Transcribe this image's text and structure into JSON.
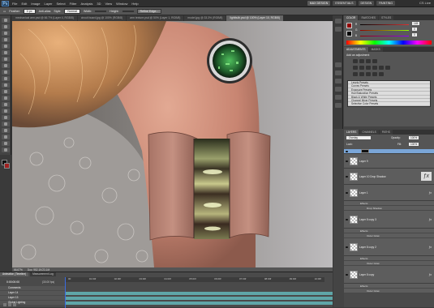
{
  "app": {
    "logo": "Ps"
  },
  "menubar": {
    "items": [
      "File",
      "Edit",
      "Image",
      "Layer",
      "Select",
      "Filter",
      "Analysis",
      "3D",
      "View",
      "Window",
      "Help"
    ],
    "zoom": "66.7",
    "workspaces": [
      "MAX DESIGN",
      "ESSENTIALS",
      "DESIGN",
      "PAINTING"
    ],
    "cs_live": "CS Live"
  },
  "options_bar": {
    "feather_label": "Feather:",
    "feather_value": "0 px",
    "antialias_label": "Anti-alias",
    "style_label": "Style:",
    "style_value": "Normal",
    "width_label": "Width:",
    "height_label": "Height:",
    "refine_edge": "Refine Edge..."
  },
  "doc_tabs": [
    {
      "label": "mechanical arm.psd @ 66.7% (Layer 4, RGB/8)",
      "active": false
    },
    {
      "label": "circuit board.jpg @ 100% (RGB/8)",
      "active": false
    },
    {
      "label": "arm texture.psd @ 50% (Layer 1, RGB/8)",
      "active": false
    },
    {
      "label": "model.jpg @ 33.3% (RGB/8)",
      "active": false
    },
    {
      "label": "lightbulb.psd @ 100% (Layer 10, RGB/8)",
      "active": true
    }
  ],
  "status": {
    "zoom": "66.67%",
    "doc": "Doc: 952.1K/23.1M"
  },
  "animation": {
    "tabs": [
      "Animation (Timeline)",
      "Measurement Log"
    ],
    "current_time": "0:00:00:00",
    "fps": "(30.00 fps)",
    "ruler_ticks": [
      "00",
      "01:00f",
      "02:00f",
      "03:00f",
      "04:00f",
      "05:00f",
      "06:00f",
      "07:00f",
      "08:00f",
      "09:00f",
      "10:00f"
    ],
    "tracks": [
      "Comments",
      "Layer 14",
      "Layer 13",
      "Global Lighting"
    ]
  },
  "color_panel": {
    "tabs": [
      "COLOR",
      "SWATCHES",
      "STYLES"
    ],
    "channels": [
      "R",
      "G",
      "B"
    ],
    "values": [
      "145",
      "0",
      "0"
    ],
    "channel_colors": [
      "#e03030",
      "#30c040",
      "#3050e0"
    ]
  },
  "adjustments_panel": {
    "tabs": [
      "ADJUSTMENTS",
      "MASKS"
    ],
    "title": "Add an adjustment",
    "presets": [
      "Levels Presets",
      "Curves Presets",
      "Exposure Presets",
      "Hue/Saturation Presets",
      "Black & White Presets",
      "Channel Mixer Presets",
      "Selective Color Presets"
    ]
  },
  "layers_panel": {
    "tabs": [
      "LAYERS",
      "CHANNELS",
      "PATHS"
    ],
    "blend_mode": "Overlay",
    "opacity_label": "Opacity:",
    "opacity_value": "100%",
    "lock_label": "Lock:",
    "fill_label": "Fill:",
    "fill_value": "100%",
    "layers": [
      {
        "name": "Layer 10",
        "fx": false
      },
      {
        "name": "Layer 9",
        "fx": false
      },
      {
        "name": "Layer 10 Drop Shadow",
        "fx": true
      },
      {
        "name": "Layer 1",
        "fx": true
      },
      {
        "name": "Layer 8 copy 3",
        "fx": true
      },
      {
        "name": "Layer 8 copy 2",
        "fx": true
      },
      {
        "name": "Layer 8 copy",
        "fx": true
      }
    ],
    "effects": [
      "Effects",
      "Drop Shadow",
      "Effects",
      "Outer Glow",
      "Effects",
      "Outer Glow",
      "Effects",
      "Outer Glow"
    ]
  }
}
